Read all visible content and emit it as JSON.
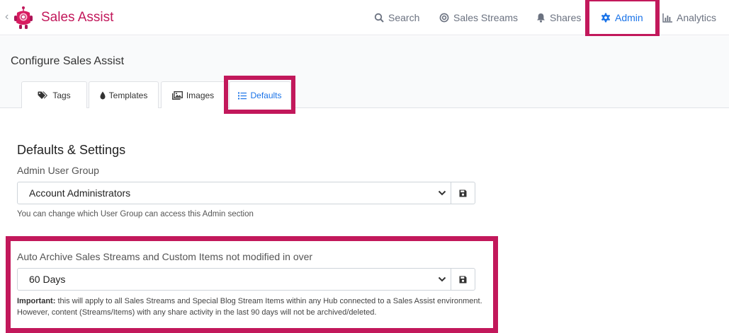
{
  "app": {
    "title": "Sales Assist",
    "brand_color": "#c2185b"
  },
  "nav": {
    "items": [
      {
        "label": "Search",
        "icon": "search-icon"
      },
      {
        "label": "Sales Streams",
        "icon": "streams-icon"
      },
      {
        "label": "Shares",
        "icon": "bell-icon"
      },
      {
        "label": "Admin",
        "icon": "gear-icon",
        "active": true
      },
      {
        "label": "Analytics",
        "icon": "bar-chart-icon"
      }
    ],
    "active_color": "#1a73e8"
  },
  "page": {
    "title": "Configure Sales Assist",
    "tabs": [
      {
        "label": "Tags",
        "icon": "tags-icon"
      },
      {
        "label": "Templates",
        "icon": "drop-icon"
      },
      {
        "label": "Images",
        "icon": "images-icon"
      },
      {
        "label": "Defaults",
        "icon": "list-icon",
        "active": true
      }
    ]
  },
  "settings": {
    "section_title": "Defaults & Settings",
    "admin_group": {
      "label": "Admin User Group",
      "value": "Account Administrators",
      "help": "You can change which User Group can access this Admin section"
    },
    "auto_archive": {
      "label": "Auto Archive Sales Streams and Custom Items not modified in over",
      "value": "60 Days",
      "note_strong": "Important:",
      "note_text": "this will apply to all Sales Streams and Special Blog Stream Items within any Hub connected to a Sales Assist environment. However, content (Streams/Items) with any share activity in the last 90 days will not be archived/deleted."
    }
  }
}
